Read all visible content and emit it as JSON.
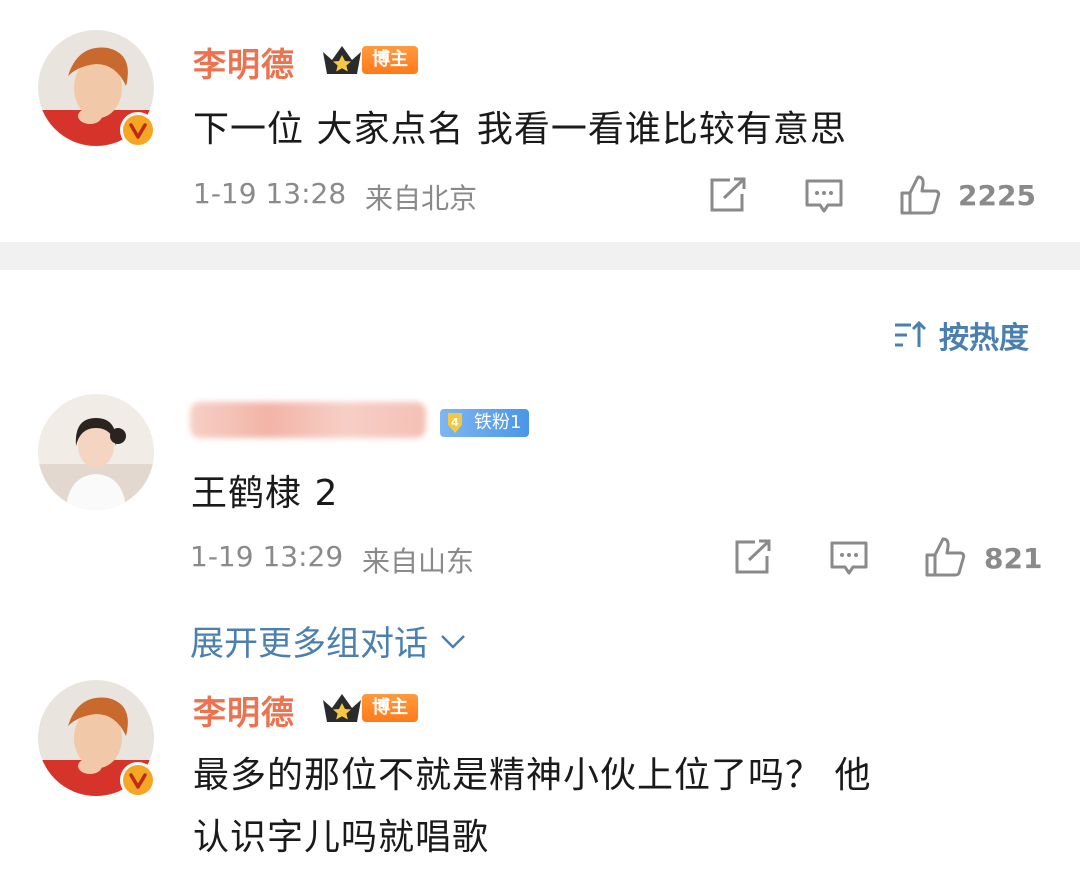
{
  "comments": [
    {
      "user": "李明德",
      "badge": "博主",
      "text": "下一位 大家点名 我看一看谁比较有意思",
      "time": "1-19 13:28",
      "location": "来自北京",
      "likes": "2225"
    },
    {
      "user": "",
      "badge": "铁粉1",
      "text": "王鹤棣 2",
      "time": "1-19 13:29",
      "location": "来自山东",
      "likes": "821"
    },
    {
      "user": "李明德",
      "badge": "博主",
      "text_line1": "最多的那位不就是精神小伙上位了吗？ 他",
      "text_line2": "认识字儿吗就唱歌"
    }
  ],
  "sort": {
    "label": "按热度"
  },
  "expand": {
    "label": "展开更多组对话"
  },
  "colors": {
    "name": "#eb7350",
    "link": "#4a7fb0",
    "meta": "#8a8a8a"
  }
}
